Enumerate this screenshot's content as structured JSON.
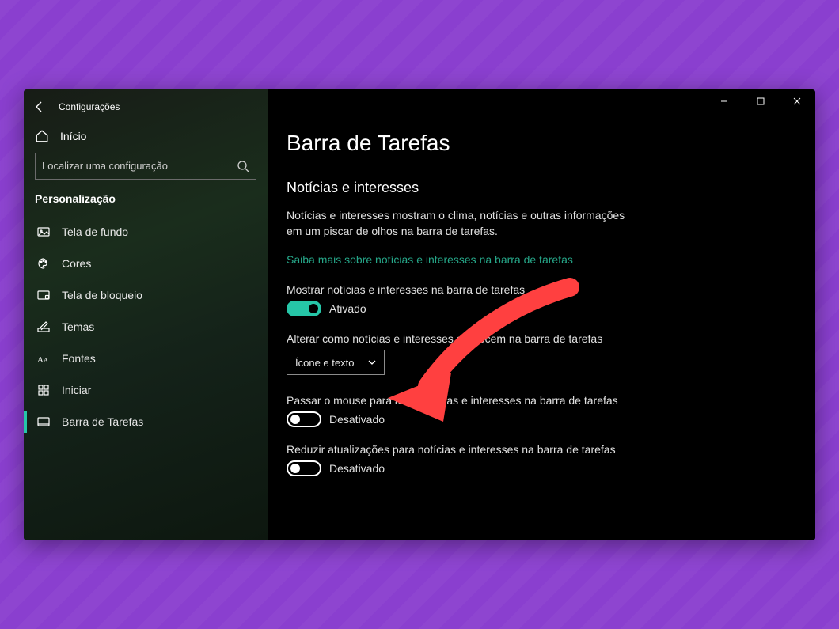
{
  "colors": {
    "accent": "#26c6a8",
    "link": "#26a789",
    "annotation_arrow": "#ff4040"
  },
  "titlebar": {
    "app_name": "Configurações",
    "back_icon": "back-arrow"
  },
  "window_controls": {
    "minimize": "minimize",
    "maximize": "maximize",
    "close": "close"
  },
  "sidebar": {
    "home_label": "Início",
    "search_placeholder": "Localizar uma configuração",
    "section_title": "Personalização",
    "items": [
      {
        "icon": "image-icon",
        "label": "Tela de fundo",
        "active": false
      },
      {
        "icon": "palette-icon",
        "label": "Cores",
        "active": false
      },
      {
        "icon": "lockscreen-icon",
        "label": "Tela de bloqueio",
        "active": false
      },
      {
        "icon": "pencil-icon",
        "label": "Temas",
        "active": false
      },
      {
        "icon": "font-icon",
        "label": "Fontes",
        "active": false
      },
      {
        "icon": "grid-icon",
        "label": "Iniciar",
        "active": false
      },
      {
        "icon": "taskbar-icon",
        "label": "Barra de Tarefas",
        "active": true
      }
    ]
  },
  "main": {
    "page_title": "Barra de Tarefas",
    "section_heading": "Notícias e interesses",
    "description": "Notícias e interesses mostram o clima, notícias e outras informações em um piscar de olhos na barra de tarefas.",
    "learn_more": "Saiba mais sobre notícias e interesses na barra de tarefas",
    "settings": [
      {
        "label": "Mostrar notícias e interesses na barra de tarefas",
        "type": "toggle",
        "state_text": "Ativado",
        "on": true
      },
      {
        "label": "Alterar como notícias e interesses aparecem na barra de tarefas",
        "type": "select",
        "value": "Ícone e texto"
      },
      {
        "label": "Passar o mouse para abrir notícias e interesses na barra de tarefas",
        "type": "toggle",
        "state_text": "Desativado",
        "on": false
      },
      {
        "label": "Reduzir atualizações para notícias e interesses na barra de tarefas",
        "type": "toggle",
        "state_text": "Desativado",
        "on": false
      }
    ]
  },
  "annotation": {
    "kind": "arrow",
    "color": "#ff4040",
    "points_to": "toggle-show-news"
  }
}
